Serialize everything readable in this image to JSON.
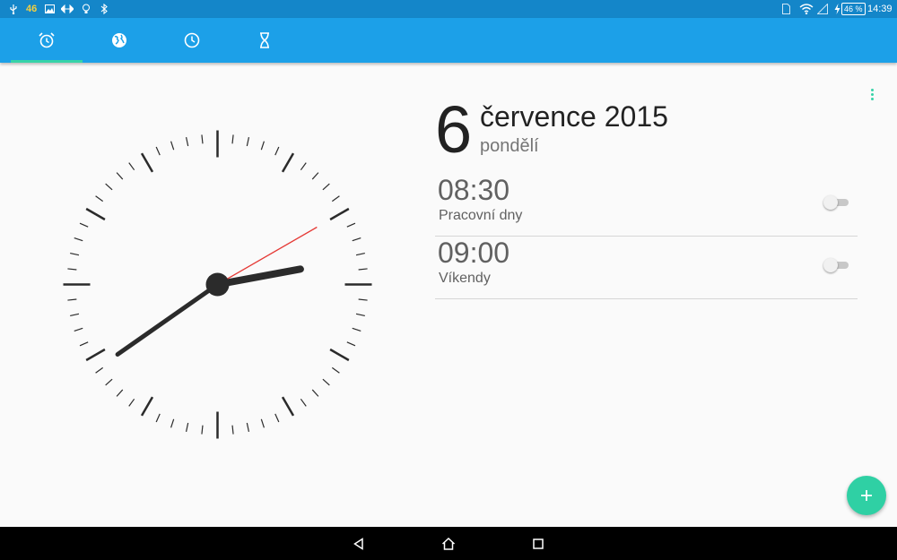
{
  "status_bar": {
    "badge": "46",
    "battery": "46 %",
    "time": "14:39",
    "left_icons": [
      "usb-icon",
      "image-icon",
      "data-transfer-icon",
      "lightbulb-icon",
      "bluetooth-icon"
    ],
    "right_icons": [
      "sim-icon",
      "wifi-icon",
      "signal-icon",
      "charging-icon",
      "battery-icon"
    ]
  },
  "tabs": [
    {
      "name": "alarm",
      "icon": "alarm-clock-icon",
      "active": true
    },
    {
      "name": "world-clock",
      "icon": "globe-icon",
      "active": false
    },
    {
      "name": "clock",
      "icon": "clock-icon",
      "active": false
    },
    {
      "name": "timer",
      "icon": "hourglass-icon",
      "active": false
    }
  ],
  "analog_clock": {
    "hours": 14,
    "minutes": 39,
    "seconds": 10
  },
  "date": {
    "day": "6",
    "month_year": "července 2015",
    "weekday": "pondělí"
  },
  "alarms": [
    {
      "time": "08:30",
      "label": "Pracovní dny",
      "enabled": false
    },
    {
      "time": "09:00",
      "label": "Víkendy",
      "enabled": false
    }
  ],
  "fab_label": "+",
  "colors": {
    "status_bar": "#1486c9",
    "toolbar": "#1ca0e8",
    "accent": "#37d3a8",
    "second_hand": "#e53935",
    "hands": "#2b2b2b"
  }
}
